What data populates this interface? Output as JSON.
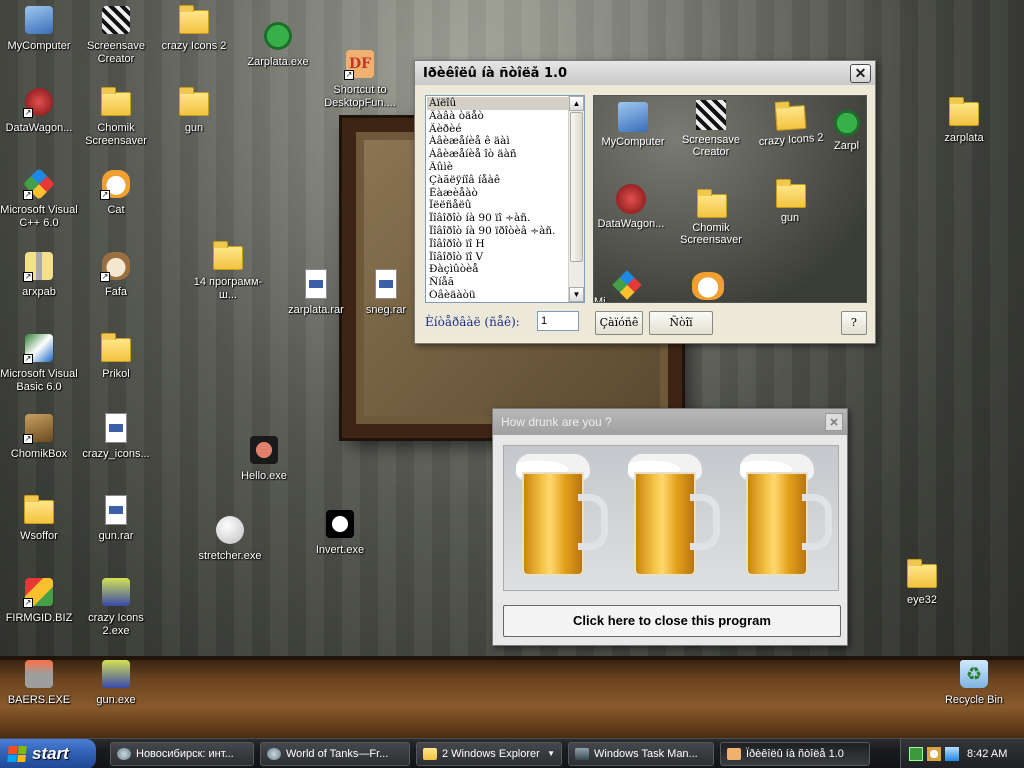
{
  "desktop_icons": [
    {
      "label": "MyComputer",
      "icon": "computer-icon"
    },
    {
      "label": "Screensave Creator",
      "icon": "clapperboard-icon"
    },
    {
      "label": "crazy Icons 2",
      "icon": "folder-icon"
    },
    {
      "label": "Zarplata.exe",
      "icon": "sberbank-logo-icon"
    },
    {
      "label": "Shortcut to DesktopFun....",
      "icon": "df-app-icon"
    },
    {
      "label": "DataWagon...",
      "icon": "datawagon-icon"
    },
    {
      "label": "Chomik Screensaver",
      "icon": "folder-icon"
    },
    {
      "label": "gun",
      "icon": "folder-icon"
    },
    {
      "label": "zarplata",
      "icon": "folder-icon"
    },
    {
      "label": "Microsoft Visual C++ 6.0",
      "icon": "visual-cpp-icon"
    },
    {
      "label": "Cat",
      "icon": "cat-icon"
    },
    {
      "label": "14 программ-ш...",
      "icon": "folder-icon"
    },
    {
      "label": "zarplata.rar",
      "icon": "rar-archive-icon"
    },
    {
      "label": "sneg.rar",
      "icon": "rar-archive-icon"
    },
    {
      "label": "arxpab",
      "icon": "zip-archive-icon"
    },
    {
      "label": "Fafa",
      "icon": "cat-icon"
    },
    {
      "label": "Microsoft Visual Basic 6.0",
      "icon": "visual-basic-icon"
    },
    {
      "label": "Prikol",
      "icon": "folder-icon"
    },
    {
      "label": "ChomikBox",
      "icon": "chomikbox-icon"
    },
    {
      "label": "crazy_icons...",
      "icon": "document-icon"
    },
    {
      "label": "Hello.exe",
      "icon": "hand-icon"
    },
    {
      "label": "Wsoffor",
      "icon": "folder-icon"
    },
    {
      "label": "gun.rar",
      "icon": "rar-archive-icon"
    },
    {
      "label": "stretcher.exe",
      "icon": "smiley-icon"
    },
    {
      "label": "Invert.exe",
      "icon": "face-icon"
    },
    {
      "label": "FIRMGID.BIZ",
      "icon": "firmgid-icon"
    },
    {
      "label": "crazy Icons 2.exe",
      "icon": "exe-icon"
    },
    {
      "label": "eye32",
      "icon": "folder-icon"
    },
    {
      "label": "BAERS.EXE",
      "icon": "baers-icon"
    },
    {
      "label": "gun.exe",
      "icon": "exe-icon"
    },
    {
      "label": "Recycle Bin",
      "icon": "recycle-bin-icon"
    }
  ],
  "desktop_window": {
    "title": "Ïðèêîëû íà ñòîëå 1.0",
    "list_items": [
      "Àïëîû",
      "Äàâà òäåò",
      "Äèðèé",
      "Àâèæåíèå ê äàì",
      "Àâèæåíèå îò äàñ",
      "Äûìè",
      "Çàãëÿíîâ íåàê",
      "Êàæèåàò",
      "Ïëëñåëû",
      "Ïîâîðîò íà 90 ïî ÷àñ.",
      "Ïîâîðîò íà 90 ïðîòèâ ÷àñ.",
      "Ïîâîðîò ïî H",
      "Ïîâîðîò ïî V",
      "Ðàçìûòèå",
      "Ñíåã",
      "Óâèäàòü"
    ],
    "preview_icons": [
      {
        "label": "MyComputer",
        "icon": "computer-icon"
      },
      {
        "label": "Screensave Creator",
        "icon": "clapperboard-icon"
      },
      {
        "label": "crazy Icons 2",
        "icon": "folder-icon"
      },
      {
        "label": "Zarpl",
        "icon": "sberbank-logo-icon"
      },
      {
        "label": "DataWagon...",
        "icon": "datawagon-icon"
      },
      {
        "label": "Chomik Screensaver",
        "icon": "folder-icon"
      },
      {
        "label": "gun",
        "icon": "folder-icon"
      },
      {
        "label": "Mi",
        "icon": "visual-cpp-icon"
      },
      {
        "label": "",
        "icon": "cat-icon"
      }
    ],
    "interval_label": "Èíòåðâàë (ñåê):",
    "interval_value": "1",
    "start_button": "Çàïóñê",
    "stop_button": "Ñòîï",
    "help_button": "?"
  },
  "drunk_window": {
    "title": "How drunk are you ?",
    "beer_count": 3,
    "close_button": "Click here to close this program"
  },
  "taskbar": {
    "start_label": "start",
    "tasks": [
      {
        "label": "Новосибирск: инт...",
        "icon": "browser-icon"
      },
      {
        "label": "World of Tanks—Fr...",
        "icon": "browser-icon"
      },
      {
        "label": "2 Windows Explorer",
        "icon": "folder-icon",
        "has_dropdown": true
      },
      {
        "label": "Windows Task Man...",
        "icon": "task-manager-icon"
      },
      {
        "label": "Ïðèêîëû íà ñòîëå 1.0",
        "icon": "df-app-icon",
        "active": true
      }
    ],
    "clock": "8:42 AM"
  },
  "colors": {
    "xp_start_green": "#3c9a3c",
    "titlebar_gray": "#a8a8a8",
    "beer": "#e3a21c"
  }
}
